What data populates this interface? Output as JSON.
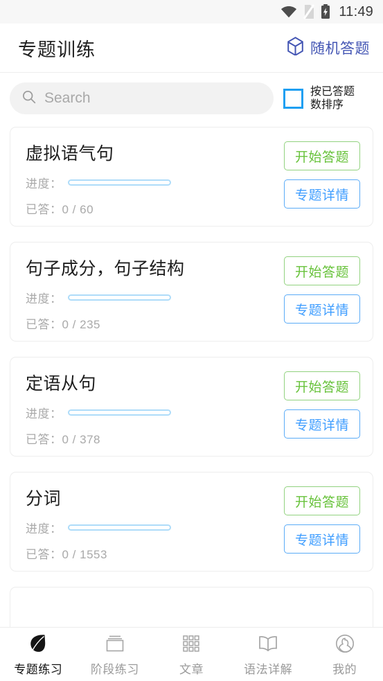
{
  "statusbar": {
    "time": "11:49",
    "icons": [
      "wifi-icon",
      "no-sim-icon",
      "battery-charging-icon"
    ]
  },
  "header": {
    "title": "专题训练",
    "random_label": "随机答题",
    "random_icon": "cube-icon",
    "accent_color": "#4456b4"
  },
  "search": {
    "icon": "search-icon",
    "placeholder": "Search",
    "value": ""
  },
  "sort": {
    "checked": false,
    "label_line1": "按已答题",
    "label_line2": "数排序",
    "checkbox_color": "#1e9ff2"
  },
  "buttons": {
    "start_label": "开始答题",
    "detail_label": "专题详情",
    "start_color": "#67c23a",
    "detail_color": "#409eff"
  },
  "labels": {
    "progress_prefix": "进度：",
    "answered_prefix": "已答：",
    "progress_bar_color": "#aedcf9"
  },
  "topics": [
    {
      "title": "虚拟语气句",
      "progress_percent": 0,
      "answered": "0 / 60",
      "answered_text": "已答：0 / 60"
    },
    {
      "title": "句子成分，句子结构",
      "progress_percent": 0,
      "answered": "0 / 235",
      "answered_text": "已答：0 / 235"
    },
    {
      "title": "定语从句",
      "progress_percent": 0,
      "answered": "0 / 378",
      "answered_text": "已答：0 / 378"
    },
    {
      "title": "分词",
      "progress_percent": 0,
      "answered": "0 / 1553",
      "answered_text": "已答：0 / 1553"
    }
  ],
  "bottom_nav": {
    "active_index": 0,
    "items": [
      {
        "label": "专题练习",
        "icon": "leaf-icon"
      },
      {
        "label": "阶段练习",
        "icon": "stacked-cards-icon"
      },
      {
        "label": "文章",
        "icon": "grid-icon"
      },
      {
        "label": "语法详解",
        "icon": "book-icon"
      },
      {
        "label": "我的",
        "icon": "person-circle-icon"
      }
    ]
  }
}
